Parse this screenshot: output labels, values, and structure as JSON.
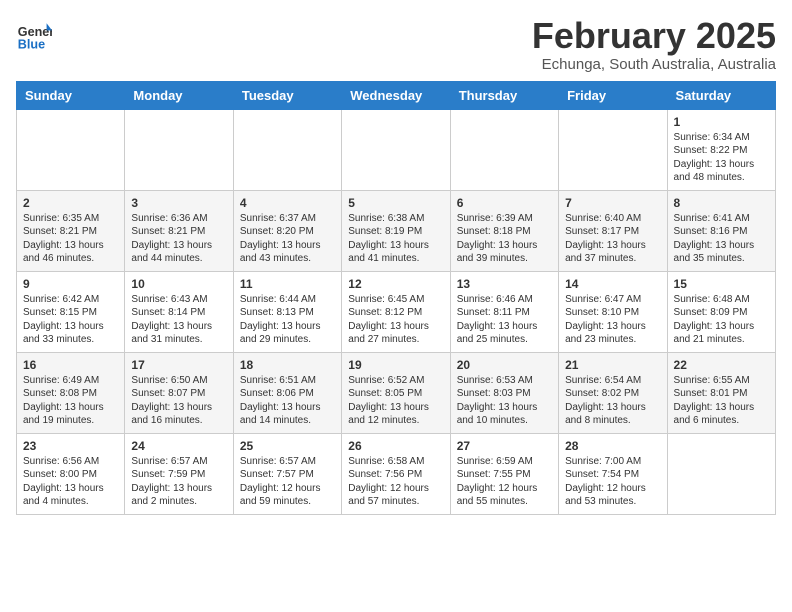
{
  "header": {
    "logo_general": "General",
    "logo_blue": "Blue",
    "month_year": "February 2025",
    "location": "Echunga, South Australia, Australia"
  },
  "weekdays": [
    "Sunday",
    "Monday",
    "Tuesday",
    "Wednesday",
    "Thursday",
    "Friday",
    "Saturday"
  ],
  "weeks": [
    [
      {
        "day": "",
        "info": ""
      },
      {
        "day": "",
        "info": ""
      },
      {
        "day": "",
        "info": ""
      },
      {
        "day": "",
        "info": ""
      },
      {
        "day": "",
        "info": ""
      },
      {
        "day": "",
        "info": ""
      },
      {
        "day": "1",
        "info": "Sunrise: 6:34 AM\nSunset: 8:22 PM\nDaylight: 13 hours and 48 minutes."
      }
    ],
    [
      {
        "day": "2",
        "info": "Sunrise: 6:35 AM\nSunset: 8:21 PM\nDaylight: 13 hours and 46 minutes."
      },
      {
        "day": "3",
        "info": "Sunrise: 6:36 AM\nSunset: 8:21 PM\nDaylight: 13 hours and 44 minutes."
      },
      {
        "day": "4",
        "info": "Sunrise: 6:37 AM\nSunset: 8:20 PM\nDaylight: 13 hours and 43 minutes."
      },
      {
        "day": "5",
        "info": "Sunrise: 6:38 AM\nSunset: 8:19 PM\nDaylight: 13 hours and 41 minutes."
      },
      {
        "day": "6",
        "info": "Sunrise: 6:39 AM\nSunset: 8:18 PM\nDaylight: 13 hours and 39 minutes."
      },
      {
        "day": "7",
        "info": "Sunrise: 6:40 AM\nSunset: 8:17 PM\nDaylight: 13 hours and 37 minutes."
      },
      {
        "day": "8",
        "info": "Sunrise: 6:41 AM\nSunset: 8:16 PM\nDaylight: 13 hours and 35 minutes."
      }
    ],
    [
      {
        "day": "9",
        "info": "Sunrise: 6:42 AM\nSunset: 8:15 PM\nDaylight: 13 hours and 33 minutes."
      },
      {
        "day": "10",
        "info": "Sunrise: 6:43 AM\nSunset: 8:14 PM\nDaylight: 13 hours and 31 minutes."
      },
      {
        "day": "11",
        "info": "Sunrise: 6:44 AM\nSunset: 8:13 PM\nDaylight: 13 hours and 29 minutes."
      },
      {
        "day": "12",
        "info": "Sunrise: 6:45 AM\nSunset: 8:12 PM\nDaylight: 13 hours and 27 minutes."
      },
      {
        "day": "13",
        "info": "Sunrise: 6:46 AM\nSunset: 8:11 PM\nDaylight: 13 hours and 25 minutes."
      },
      {
        "day": "14",
        "info": "Sunrise: 6:47 AM\nSunset: 8:10 PM\nDaylight: 13 hours and 23 minutes."
      },
      {
        "day": "15",
        "info": "Sunrise: 6:48 AM\nSunset: 8:09 PM\nDaylight: 13 hours and 21 minutes."
      }
    ],
    [
      {
        "day": "16",
        "info": "Sunrise: 6:49 AM\nSunset: 8:08 PM\nDaylight: 13 hours and 19 minutes."
      },
      {
        "day": "17",
        "info": "Sunrise: 6:50 AM\nSunset: 8:07 PM\nDaylight: 13 hours and 16 minutes."
      },
      {
        "day": "18",
        "info": "Sunrise: 6:51 AM\nSunset: 8:06 PM\nDaylight: 13 hours and 14 minutes."
      },
      {
        "day": "19",
        "info": "Sunrise: 6:52 AM\nSunset: 8:05 PM\nDaylight: 13 hours and 12 minutes."
      },
      {
        "day": "20",
        "info": "Sunrise: 6:53 AM\nSunset: 8:03 PM\nDaylight: 13 hours and 10 minutes."
      },
      {
        "day": "21",
        "info": "Sunrise: 6:54 AM\nSunset: 8:02 PM\nDaylight: 13 hours and 8 minutes."
      },
      {
        "day": "22",
        "info": "Sunrise: 6:55 AM\nSunset: 8:01 PM\nDaylight: 13 hours and 6 minutes."
      }
    ],
    [
      {
        "day": "23",
        "info": "Sunrise: 6:56 AM\nSunset: 8:00 PM\nDaylight: 13 hours and 4 minutes."
      },
      {
        "day": "24",
        "info": "Sunrise: 6:57 AM\nSunset: 7:59 PM\nDaylight: 13 hours and 2 minutes."
      },
      {
        "day": "25",
        "info": "Sunrise: 6:57 AM\nSunset: 7:57 PM\nDaylight: 12 hours and 59 minutes."
      },
      {
        "day": "26",
        "info": "Sunrise: 6:58 AM\nSunset: 7:56 PM\nDaylight: 12 hours and 57 minutes."
      },
      {
        "day": "27",
        "info": "Sunrise: 6:59 AM\nSunset: 7:55 PM\nDaylight: 12 hours and 55 minutes."
      },
      {
        "day": "28",
        "info": "Sunrise: 7:00 AM\nSunset: 7:54 PM\nDaylight: 12 hours and 53 minutes."
      },
      {
        "day": "",
        "info": ""
      }
    ]
  ]
}
